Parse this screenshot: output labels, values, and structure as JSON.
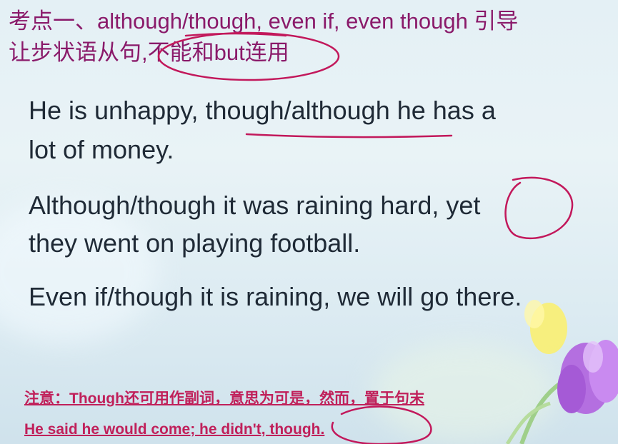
{
  "heading": {
    "line1": "考点一、although/though, even if, even though 引导",
    "line2": "让步状语从句,不能和but连用"
  },
  "examples": [
    {
      "line1": "He is unhappy, though/although he has a",
      "line2": "lot of money."
    },
    {
      "line1": "Although/though it was raining hard, yet",
      "line2": "they went on playing football."
    },
    {
      "line1": "Even if/though it is raining, we will go there."
    }
  ],
  "note": {
    "line1": "注意：Though还可用作副词，意思为可是，然而，置于句末",
    "line2": "He said he would come; he didn't, though."
  },
  "colors": {
    "heading": "#8a1a6a",
    "body": "#1f2a36",
    "note": "#c0205a",
    "ink": "#c2185b",
    "background": "#e4f0f5"
  }
}
